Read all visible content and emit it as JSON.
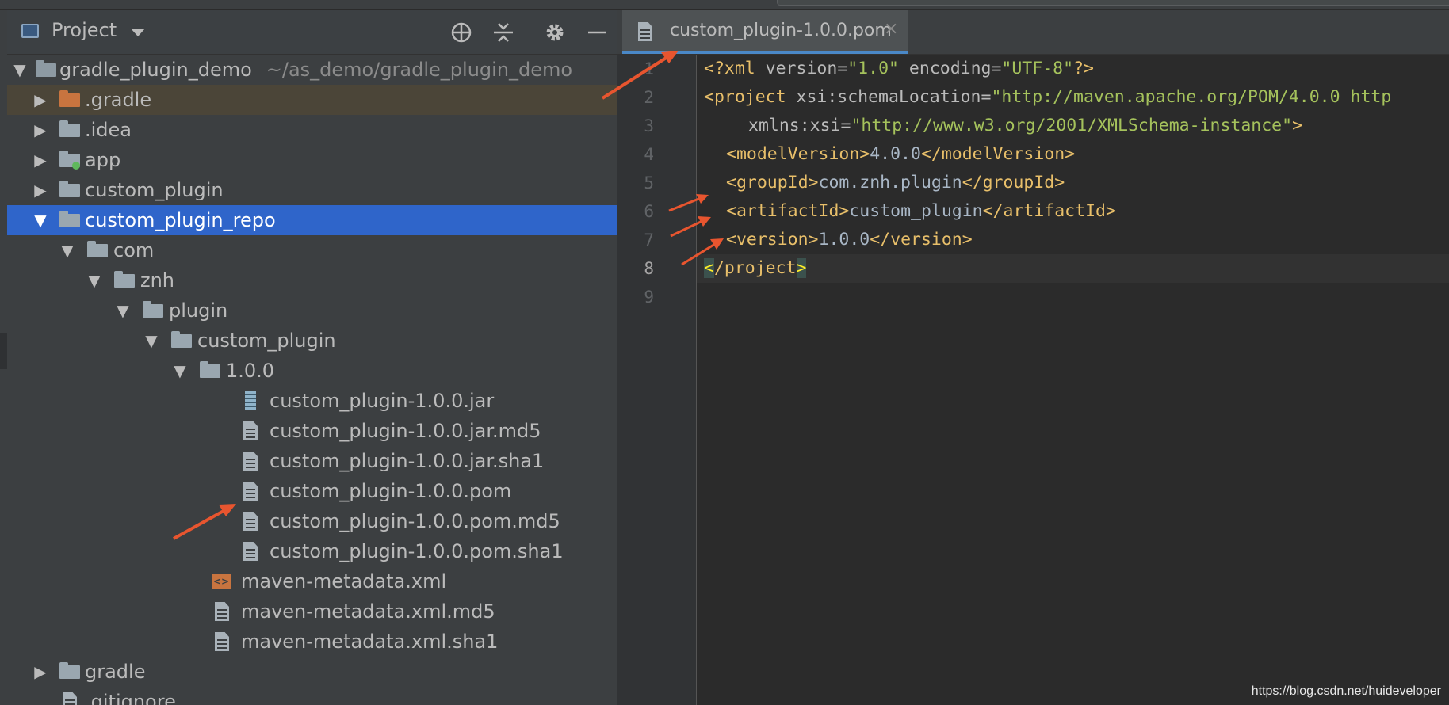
{
  "project_panel": {
    "title": "Project",
    "toolbar": [
      "locate-icon",
      "collapse-all-icon",
      "gear-icon",
      "minimize-icon"
    ],
    "tree": [
      {
        "label": "gradle_plugin_demo",
        "path": "~/as_demo/gradle_plugin_demo",
        "expanded": true
      },
      {
        "label": ".gradle",
        "expanded": false
      },
      {
        "label": ".idea",
        "expanded": false
      },
      {
        "label": "app",
        "expanded": false
      },
      {
        "label": "custom_plugin",
        "expanded": false
      },
      {
        "label": "custom_plugin_repo",
        "expanded": true,
        "selected": true
      },
      {
        "label": "com",
        "expanded": true
      },
      {
        "label": "znh",
        "expanded": true
      },
      {
        "label": "plugin",
        "expanded": true
      },
      {
        "label": "custom_plugin",
        "expanded": true
      },
      {
        "label": "1.0.0",
        "expanded": true
      },
      {
        "label": "custom_plugin-1.0.0.jar"
      },
      {
        "label": "custom_plugin-1.0.0.jar.md5"
      },
      {
        "label": "custom_plugin-1.0.0.jar.sha1"
      },
      {
        "label": "custom_plugin-1.0.0.pom"
      },
      {
        "label": "custom_plugin-1.0.0.pom.md5"
      },
      {
        "label": "custom_plugin-1.0.0.pom.sha1"
      },
      {
        "label": "maven-metadata.xml"
      },
      {
        "label": "maven-metadata.xml.md5"
      },
      {
        "label": "maven-metadata.xml.sha1"
      },
      {
        "label": "gradle",
        "expanded": false
      },
      {
        "label": ".gitignore"
      }
    ]
  },
  "editor": {
    "tab_title": "custom_plugin-1.0.0.pom",
    "close_glyph": "×",
    "current_line": "8",
    "line_numbers": [
      "1",
      "2",
      "3",
      "4",
      "5",
      "6",
      "7",
      "8",
      "9"
    ],
    "code": {
      "l1": {
        "open": "<?xml ",
        "attr": "version=",
        "v1": "\"1.0\"",
        "attr2": " encoding=",
        "v2": "\"UTF-8\"",
        "close": "?>"
      },
      "l2": {
        "open": "<project ",
        "attr": "xsi:schemaLocation=",
        "v": "\"http://maven.apache.org/POM/4.0.0 http"
      },
      "l3": {
        "attr": "xmlns:xsi=",
        "v": "\"http://www.w3.org/2001/XMLSchema-instance\"",
        "close": ">"
      },
      "l4": {
        "open": "<modelVersion>",
        "text": "4.0.0",
        "close": "</modelVersion>"
      },
      "l5": {
        "open": "<groupId>",
        "text": "com.znh.plugin",
        "close": "</groupId>"
      },
      "l6": {
        "open": "<artifactId>",
        "text": "custom_plugin",
        "close": "</artifactId>"
      },
      "l7": {
        "open": "<version>",
        "text": "1.0.0",
        "close": "</version>"
      },
      "l8": {
        "b1": "<",
        "mid": "/project",
        "b2": ">"
      }
    }
  },
  "watermark": "https://blog.csdn.net/huideveloper",
  "annotation_color": "#e8552f"
}
